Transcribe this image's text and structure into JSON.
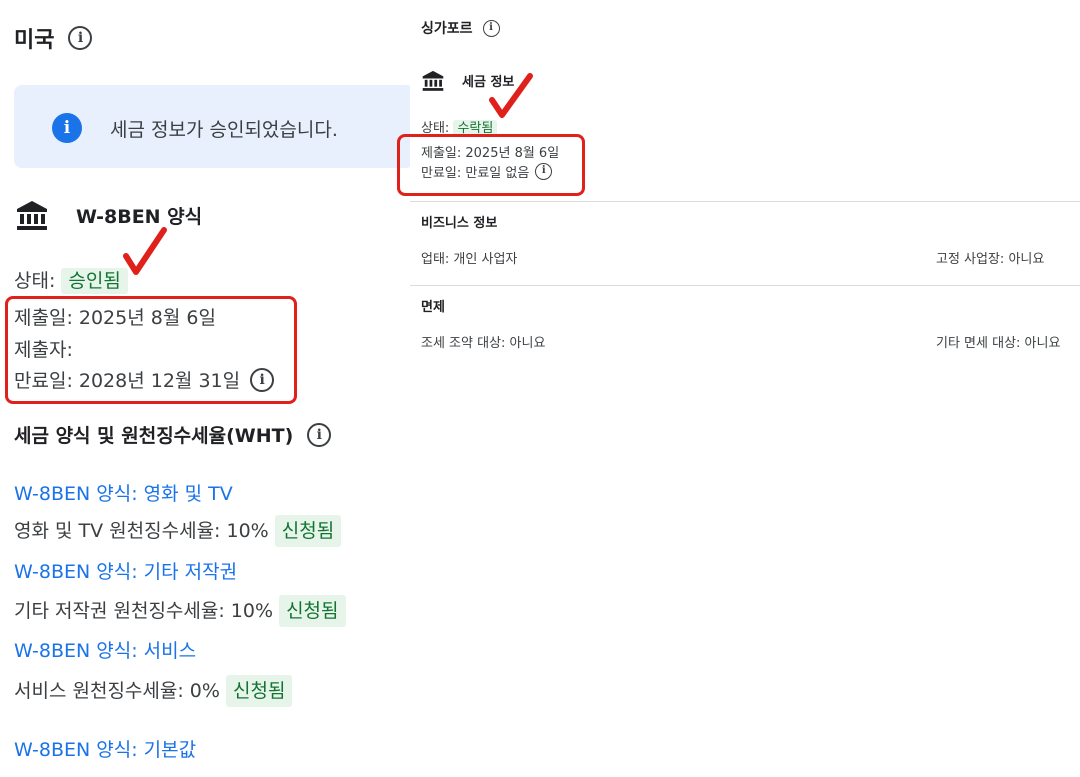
{
  "left": {
    "country": "미국",
    "banner": {
      "text": "세금 정보가 승인되었습니다."
    },
    "form_title": "W-8BEN 양식",
    "status_label": "상태:",
    "status_value": "승인됨",
    "submitted": "제출일: 2025년 8월 6일",
    "submitter": "제출자:",
    "expiry": "만료일: 2028년 12월 31일",
    "wht_title": "세금 양식 및 원천징수세율(WHT)",
    "wht_items": [
      {
        "link": "W-8BEN 양식: 영화 및 TV",
        "rate": "영화 및 TV 원천징수세율: 10%",
        "badge": "신청됨"
      },
      {
        "link": "W-8BEN 양식: 기타 저작권",
        "rate": "기타 저작권 원천징수세율: 10%",
        "badge": "신청됨"
      },
      {
        "link": "W-8BEN 양식: 서비스",
        "rate": "서비스 원천징수세율: 0%",
        "badge": "신청됨"
      },
      {
        "link": "W-8BEN 양식: 기본값"
      }
    ]
  },
  "right": {
    "country": "싱가포르",
    "tax_title": "세금 정보",
    "status_label": "상태:",
    "status_value": "수락됨",
    "submitted": "제출일: 2025년 8월 6일",
    "expiry": "만료일: 만료일 없음",
    "business_title": "비즈니스 정보",
    "business_type": "업태: 개인 사업자",
    "fixed_place": "고정 사업장: 아니요",
    "exemption_title": "면제",
    "treaty": "조세 조약 대상: 아니요",
    "other_exemption": "기타 면세 대상: 아니요"
  },
  "colors": {
    "accent_blue": "#1a73e8",
    "approved_green": "#137333",
    "annotation_red": "#e0201b",
    "banner_bg": "#e8f0fe"
  },
  "icons": [
    "info-icon",
    "bank-icon",
    "checkmark-annotation"
  ]
}
